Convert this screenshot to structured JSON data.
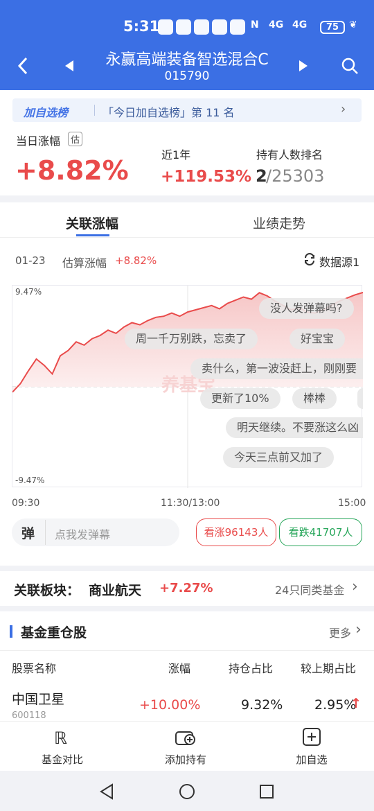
{
  "status": {
    "time": "5:31",
    "network1": "4G",
    "network2": "4G",
    "battery": "75"
  },
  "nav": {
    "title": "永赢高端装备智选混合C",
    "code": "015790"
  },
  "banner": {
    "tag": "加自选榜",
    "text": "「今日加自选榜」第 11 名"
  },
  "stats": {
    "day_label": "当日涨幅",
    "est_badge": "估",
    "day_value": "+8.82%",
    "year_label": "近1年",
    "year_value": "+119.53%",
    "rank_label": "持有人数排名",
    "rank_value": "2",
    "rank_total": "/25303"
  },
  "tabs": [
    "关联涨幅",
    "业绩走势"
  ],
  "chart_header": {
    "date": "01-23",
    "est_label": "估算涨幅",
    "est_value": "+8.82%",
    "source": "数据源1"
  },
  "chart_data": {
    "type": "line",
    "ylim": [
      -9.47,
      9.47
    ],
    "ytick_top": "9.47%",
    "ytick_bottom": "-9.47%",
    "xticks": [
      "09:30",
      "11:30/13:00",
      "15:00"
    ],
    "values": [
      -0.5,
      0.3,
      1.5,
      2.6,
      2.0,
      1.2,
      2.9,
      3.4,
      4.2,
      3.9,
      4.5,
      4.8,
      5.3,
      5.0,
      5.6,
      6.0,
      5.8,
      6.2,
      6.5,
      6.6,
      6.9,
      6.6,
      7.0,
      7.2,
      7.4,
      7.6,
      7.3,
      7.8,
      8.1,
      8.4,
      8.2,
      8.8,
      8.5,
      8.0,
      7.6,
      7.2,
      7.4,
      7.0,
      6.9,
      7.2,
      7.6,
      8.0,
      8.3,
      8.6,
      8.82
    ]
  },
  "danmu": [
    "没人发弹幕吗?",
    "周一千万别跌，忘卖了",
    "好宝宝",
    "卖什么，第一波没赶上，刚刚要",
    "更新了10%",
    "棒棒",
    "明天继续。不要涨这么凶",
    "今天三点前又加了"
  ],
  "watermark": "养基宝",
  "danmu_input": {
    "icon": "弹",
    "placeholder": "点我发弹幕"
  },
  "votes": {
    "up": "看涨96143人",
    "down": "看跌41707人"
  },
  "sector": {
    "label": "关联板块：",
    "name": "商业航天",
    "value": "+7.27%",
    "similar": "24只同类基金"
  },
  "holdings": {
    "title": "基金重仓股",
    "more": "更多",
    "headers": [
      "股票名称",
      "涨幅",
      "持仓占比",
      "较上期占比"
    ],
    "rows": [
      {
        "name": "中国卫星",
        "code": "600118",
        "change": "+10.00%",
        "ratio": "9.32%",
        "prev": "2.95%"
      }
    ]
  },
  "bottom": [
    "基金对比",
    "添加持有",
    "加自选"
  ],
  "colors": {
    "brand": "#3b6fe4",
    "up": "#e94b4b",
    "down": "#27a65a"
  }
}
